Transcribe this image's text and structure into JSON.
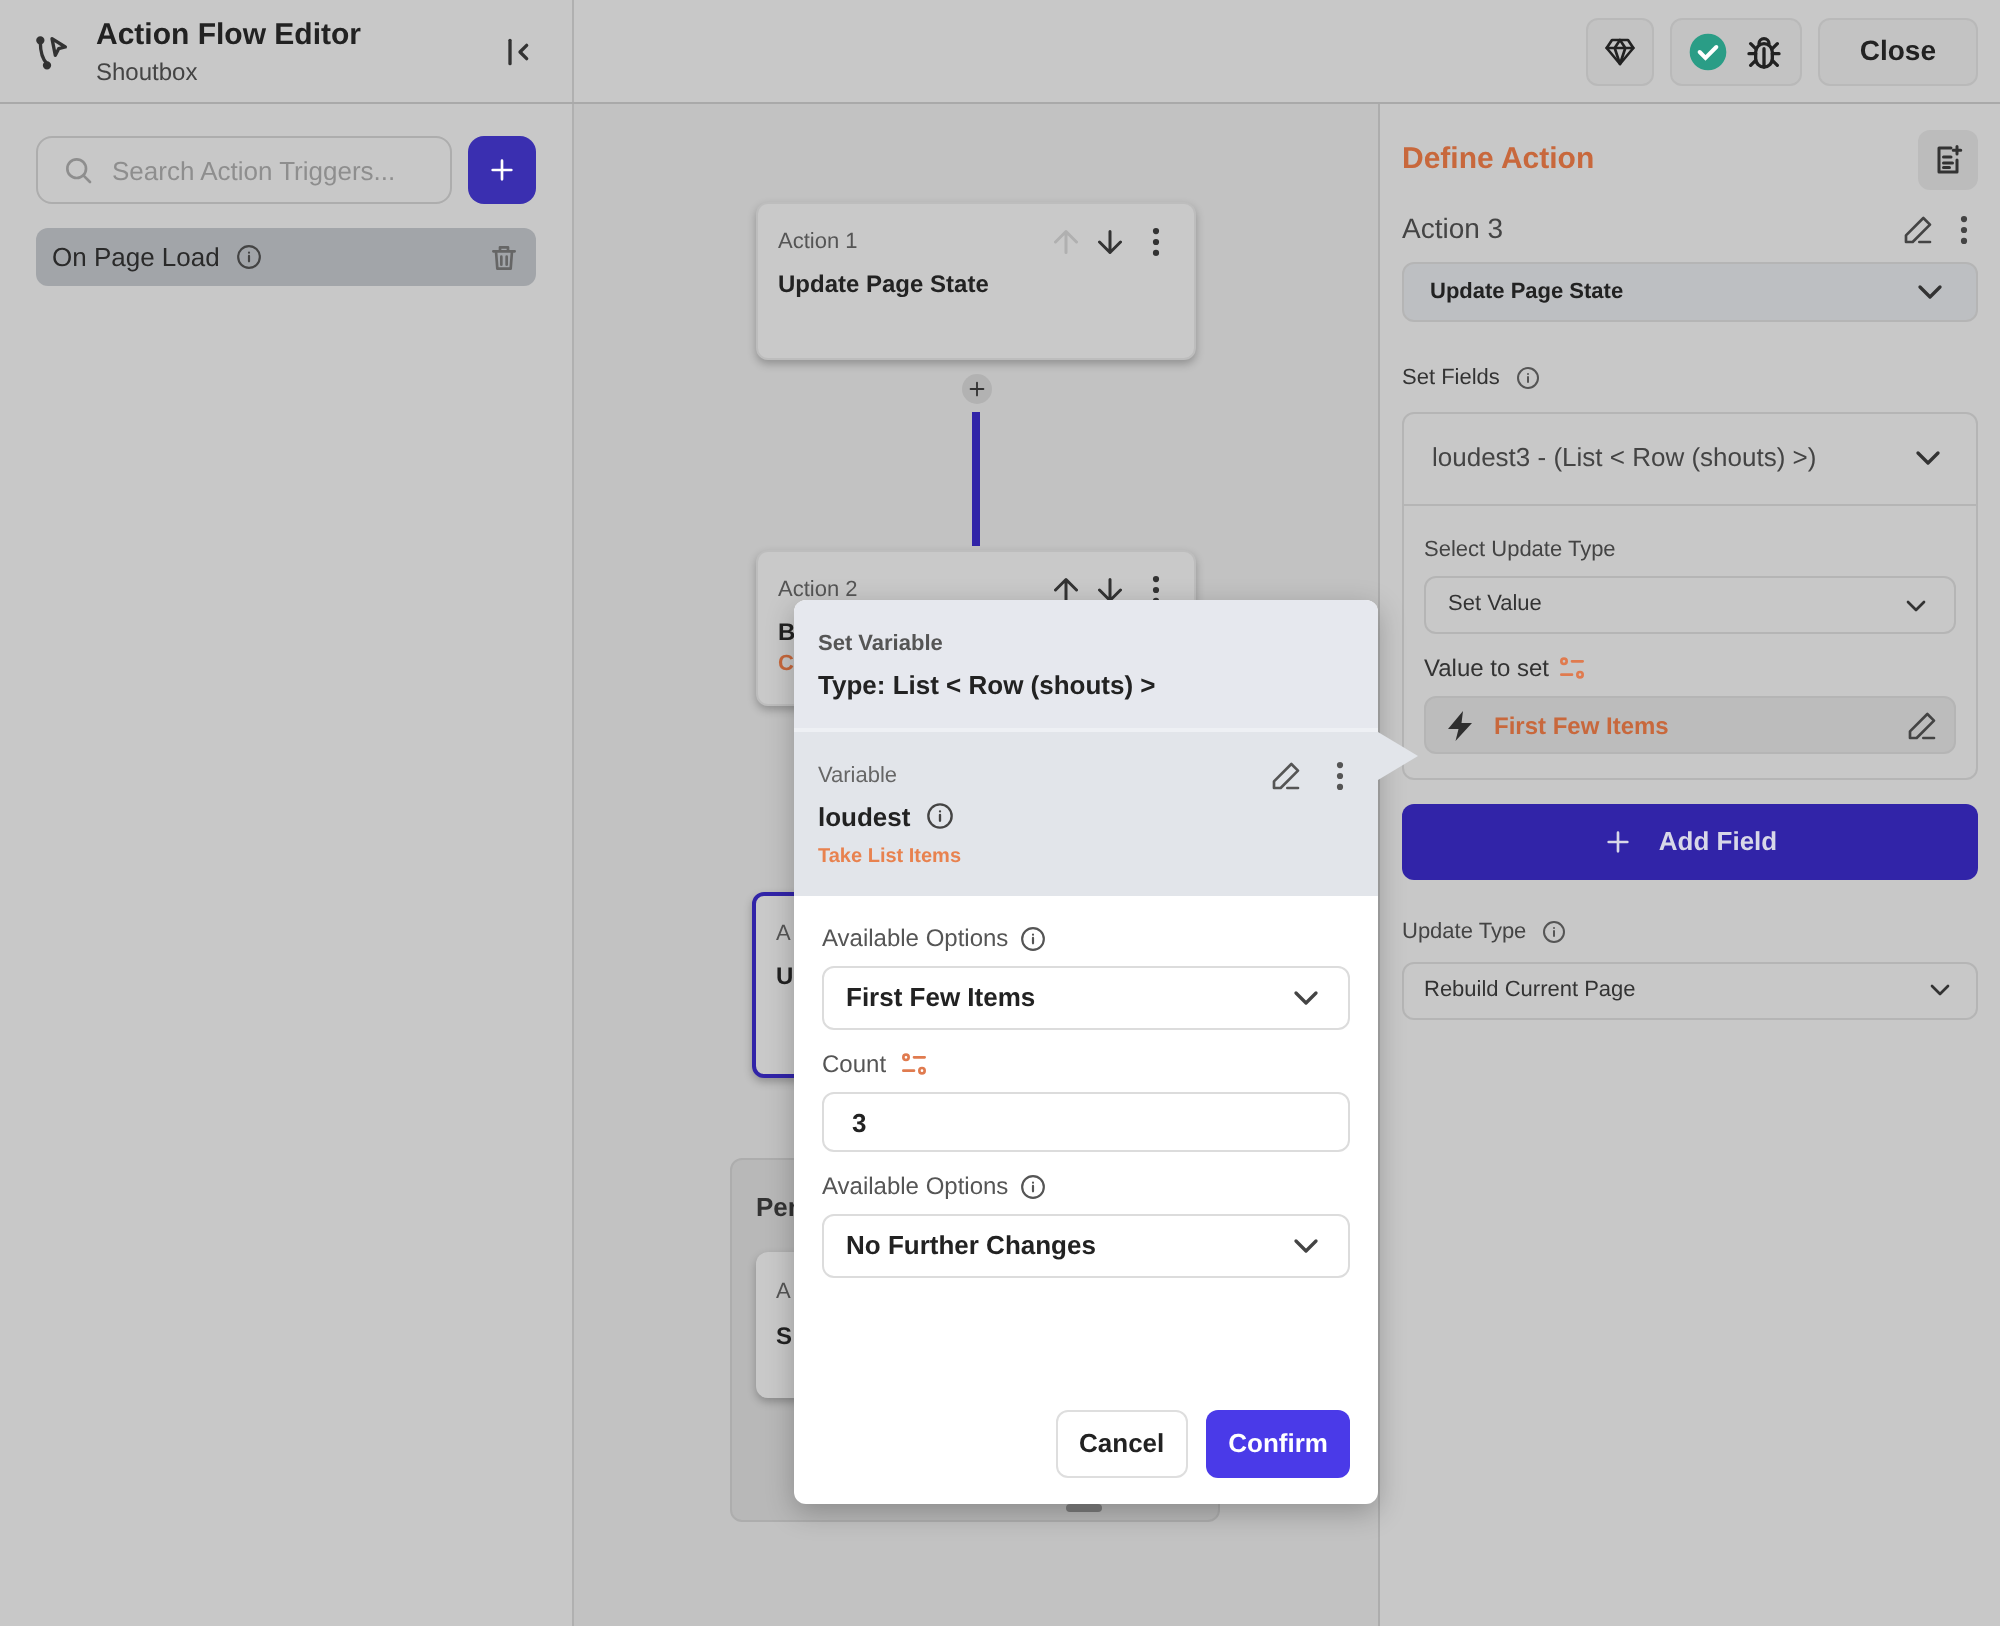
{
  "header": {
    "title": "Action Flow Editor",
    "subtitle": "Shoutbox"
  },
  "toolbar": {
    "status_ok": true,
    "close_button": "Close"
  },
  "sidebar": {
    "search": {
      "placeholder": "Search Action Triggers..."
    },
    "triggers": [
      {
        "label": "On Page Load",
        "selected": true
      }
    ]
  },
  "canvas": {
    "actions": [
      {
        "label": "Action 1",
        "title": "Update Page State",
        "up_disabled": true,
        "selected": false
      },
      {
        "label": "Action 2",
        "title": "B",
        "subtitle": "C",
        "up_disabled": false,
        "selected": false
      },
      {
        "label": "A",
        "title": "U",
        "selected": true
      }
    ],
    "group": {
      "label": "Per",
      "actions": [
        {
          "label": "A",
          "title": "S"
        }
      ]
    }
  },
  "popup": {
    "heading": "Set Variable",
    "type": "Type: List < Row (shouts) >",
    "variable_label": "Variable",
    "variable_name": "loudest",
    "transform": "Take List Items",
    "fields": [
      {
        "kind": "select",
        "label": "Available Options",
        "value": "First Few Items"
      },
      {
        "kind": "input",
        "label": "Count",
        "value": "3"
      },
      {
        "kind": "select",
        "label": "Available Options",
        "value": "No Further Changes"
      }
    ],
    "cancel": "Cancel",
    "confirm": "Confirm"
  },
  "panel": {
    "title": "Define Action",
    "action_label": "Action 3",
    "action_type": "Update Page State",
    "set_fields_label": "Set Fields",
    "field": {
      "name": "loudest3 - (List < Row (shouts) >)",
      "update_type_label": "Select Update Type",
      "update_type": "Set Value",
      "value_label": "Value to set",
      "value": "First Few Items"
    },
    "add_field": "Add Field",
    "update_type_label": "Update Type",
    "update_type": "Rebuild Current Page"
  }
}
